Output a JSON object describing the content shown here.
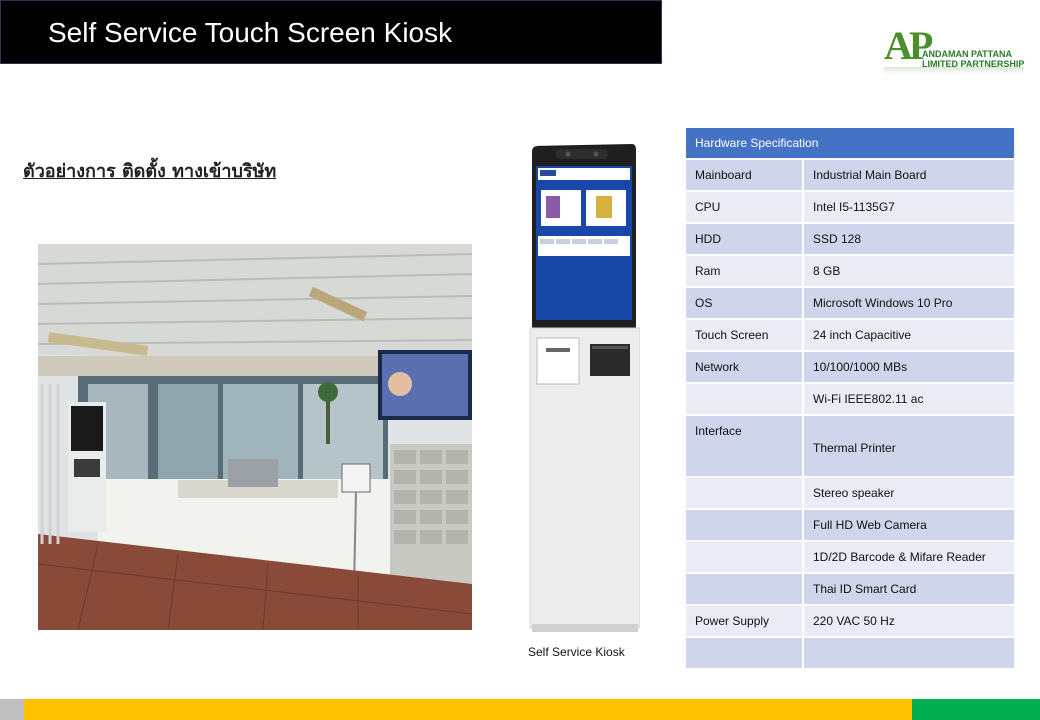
{
  "title": "Self Service Touch Screen Kiosk",
  "logo": {
    "mark": "AP",
    "line1": "ANDAMAN PATTANA",
    "line2": "LIMITED PARTNERSHIP"
  },
  "subtitle": "ตัวอย่างการ ติดตั้ง ทางเข้าบริษัท",
  "kiosk_caption": "Self Service Kiosk",
  "spec_table": {
    "header": "Hardware Specification",
    "rows": [
      {
        "label": "Mainboard",
        "value": "Industrial Main Board"
      },
      {
        "label": "CPU",
        "value": "Intel I5-1135G7"
      },
      {
        "label": "HDD",
        "value": "SSD 128"
      },
      {
        "label": "Ram",
        "value": "8 GB"
      },
      {
        "label": "OS",
        "value": "Microsoft Windows 10 Pro"
      },
      {
        "label": "Touch Screen",
        "value": "24 inch Capacitive"
      },
      {
        "label": "Network",
        "value": "10/100/1000 MBs"
      },
      {
        "label": "",
        "value": "Wi-Fi IEEE802.11 ac"
      },
      {
        "label": "Interface",
        "value": "Thermal Printer"
      },
      {
        "label": "",
        "value": "Stereo speaker"
      },
      {
        "label": "",
        "value": "Full HD Web Camera"
      },
      {
        "label": "",
        "value": "1D/2D Barcode & Mifare Reader"
      },
      {
        "label": "",
        "value": "Thai ID Smart Card"
      },
      {
        "label": "Power Supply",
        "value": "220 VAC  50 Hz"
      },
      {
        "label": "",
        "value": ""
      }
    ]
  },
  "colors": {
    "title_bg": "#000000",
    "table_header": "#4472c4",
    "table_row_dark": "#cfd5ea",
    "table_row_light": "#e9ebf5",
    "footer_yellow": "#ffc000",
    "footer_green": "#00b050",
    "footer_gray": "#bfbfbf"
  }
}
